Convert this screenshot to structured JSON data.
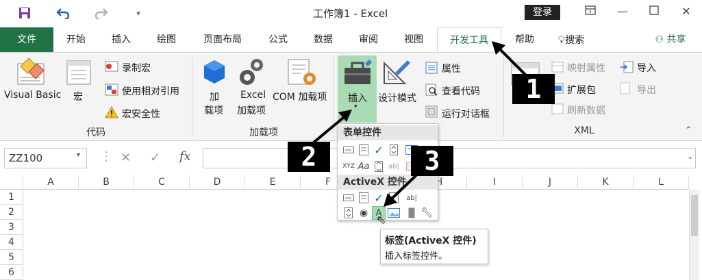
{
  "titlebar": {
    "title": "工作簿1 - Excel",
    "login": "登录"
  },
  "tabs": [
    "文件",
    "开始",
    "插入",
    "绘图",
    "页面布局",
    "公式",
    "数据",
    "审阅",
    "视图",
    "开发工具",
    "帮助"
  ],
  "tell_me": "搜索",
  "share": "共享",
  "ribbon": {
    "code": {
      "visual_basic": "Visual Basic",
      "macro": "宏",
      "record_macro": "录制宏",
      "relative_ref": "使用相对引用",
      "macro_security": "宏安全性",
      "label": "代码"
    },
    "addins": {
      "addins_line1": "加",
      "addins_line2": "载项",
      "excel_line1": "Excel",
      "excel_line2": "加载项",
      "com": "COM 加载项",
      "label": "加载项"
    },
    "controls": {
      "insert": "插入",
      "design_mode": "设计模式",
      "properties": "属性",
      "view_code": "查看代码",
      "run_dialog": "运行对话框"
    },
    "xml": {
      "source_partial": "源",
      "map_props": "映射属性",
      "expansion": "扩展包",
      "refresh": "刷新数据",
      "import": "导入",
      "export": "导出",
      "label": "XML"
    }
  },
  "formula_bar": {
    "name_box": "ZZ100",
    "fx": "fx"
  },
  "columns": [
    "A",
    "B",
    "C",
    "D",
    "E",
    "F",
    "G",
    "H",
    "I",
    "J",
    "K",
    "L"
  ],
  "rows": [
    "1",
    "2",
    "3",
    "4",
    "5",
    "6"
  ],
  "dropdown": {
    "form_controls": "表单控件",
    "activex_controls": "ActiveX 控件"
  },
  "tooltip": {
    "title": "标签(ActiveX 控件)",
    "desc": "插入标签控件。"
  },
  "badges": [
    "1",
    "2",
    "3"
  ],
  "colors": {
    "excel_green": "#217346",
    "selected_green": "#a9dcb5",
    "badge_black": "#000000"
  }
}
